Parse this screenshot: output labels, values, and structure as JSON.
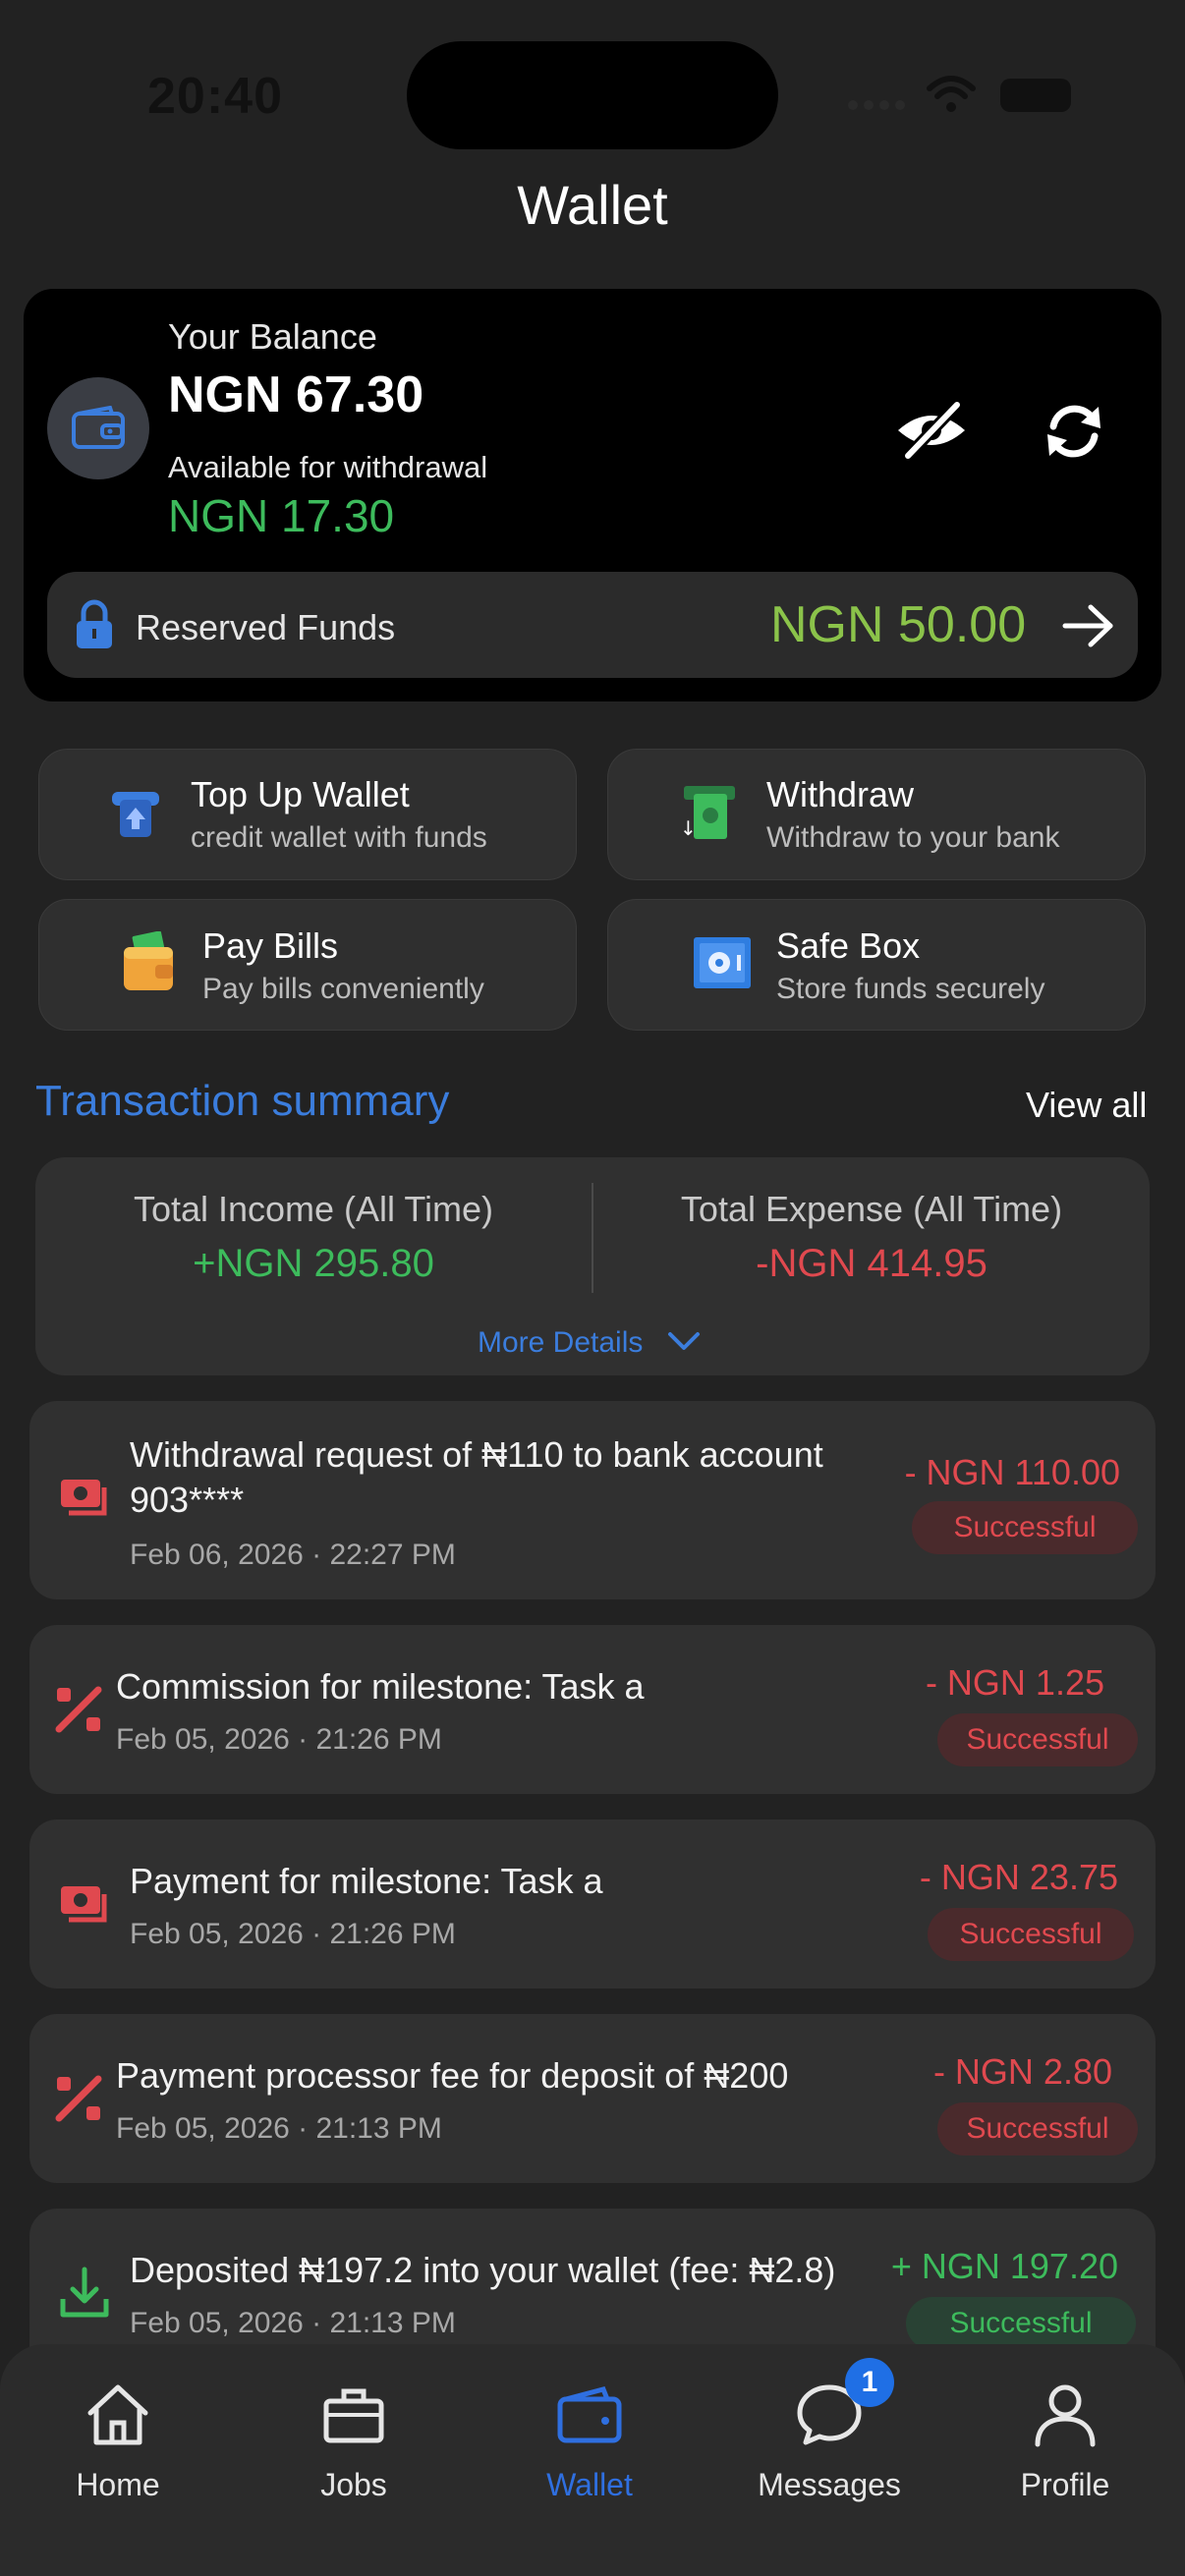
{
  "status_bar": {
    "time": "20:40"
  },
  "header": {
    "title": "Wallet"
  },
  "balance": {
    "label": "Your Balance",
    "value": "NGN 67.30",
    "available_label": "Available for withdrawal",
    "available_value": "NGN 17.30",
    "reserved_label": "Reserved Funds",
    "reserved_value": "NGN 50.00"
  },
  "actions": [
    {
      "title": "Top Up Wallet",
      "subtitle": "credit wallet with funds"
    },
    {
      "title": "Withdraw",
      "subtitle": "Withdraw to your bank"
    },
    {
      "title": "Pay Bills",
      "subtitle": "Pay bills conveniently"
    },
    {
      "title": "Safe Box",
      "subtitle": "Store funds securely"
    }
  ],
  "summary": {
    "title": "Transaction summary",
    "view_all": "View all",
    "income_label": "Total Income (All Time)",
    "income_value": "+NGN 295.80",
    "expense_label": "Total Expense (All Time)",
    "expense_value": "-NGN 414.95",
    "more_details": "More Details"
  },
  "transactions": [
    {
      "desc_line1": "Withdrawal request of ₦110 to bank account",
      "desc_line2": "903****",
      "date": "Feb 06, 2026 · 22:27 PM",
      "amount": "- NGN 110.00",
      "status": "Successful",
      "icon": "cash-icon"
    },
    {
      "desc_line1": "Commission for milestone: Task a",
      "date": "Feb 05, 2026 · 21:26 PM",
      "amount": "- NGN 1.25",
      "status": "Successful",
      "icon": "percent-icon"
    },
    {
      "desc_line1": "Payment for milestone: Task a",
      "date": "Feb 05, 2026 · 21:26 PM",
      "amount": "- NGN 23.75",
      "status": "Successful",
      "icon": "cash-icon"
    },
    {
      "desc_line1": "Payment processor fee for deposit of ₦200",
      "date": "Feb 05, 2026 · 21:13 PM",
      "amount": "- NGN 2.80",
      "status": "Successful",
      "icon": "percent-icon"
    },
    {
      "desc_line1": "Deposited ₦197.2 into your wallet (fee: ₦2.8)",
      "date": "Feb 05, 2026 · 21:13 PM",
      "amount": "+ NGN 197.20",
      "status": "Successful",
      "icon": "download-icon"
    }
  ],
  "nav": {
    "items": [
      {
        "label": "Home",
        "icon": "home-icon"
      },
      {
        "label": "Jobs",
        "icon": "briefcase-icon"
      },
      {
        "label": "Wallet",
        "icon": "wallet-icon",
        "active": true
      },
      {
        "label": "Messages",
        "icon": "chat-icon",
        "badge": "1"
      },
      {
        "label": "Profile",
        "icon": "user-icon"
      }
    ]
  },
  "colors": {
    "accent": "#2f6fe0",
    "positive": "#3dbb5c",
    "negative": "#e0494f",
    "reserved": "#8bc34a",
    "background": "#222222"
  }
}
